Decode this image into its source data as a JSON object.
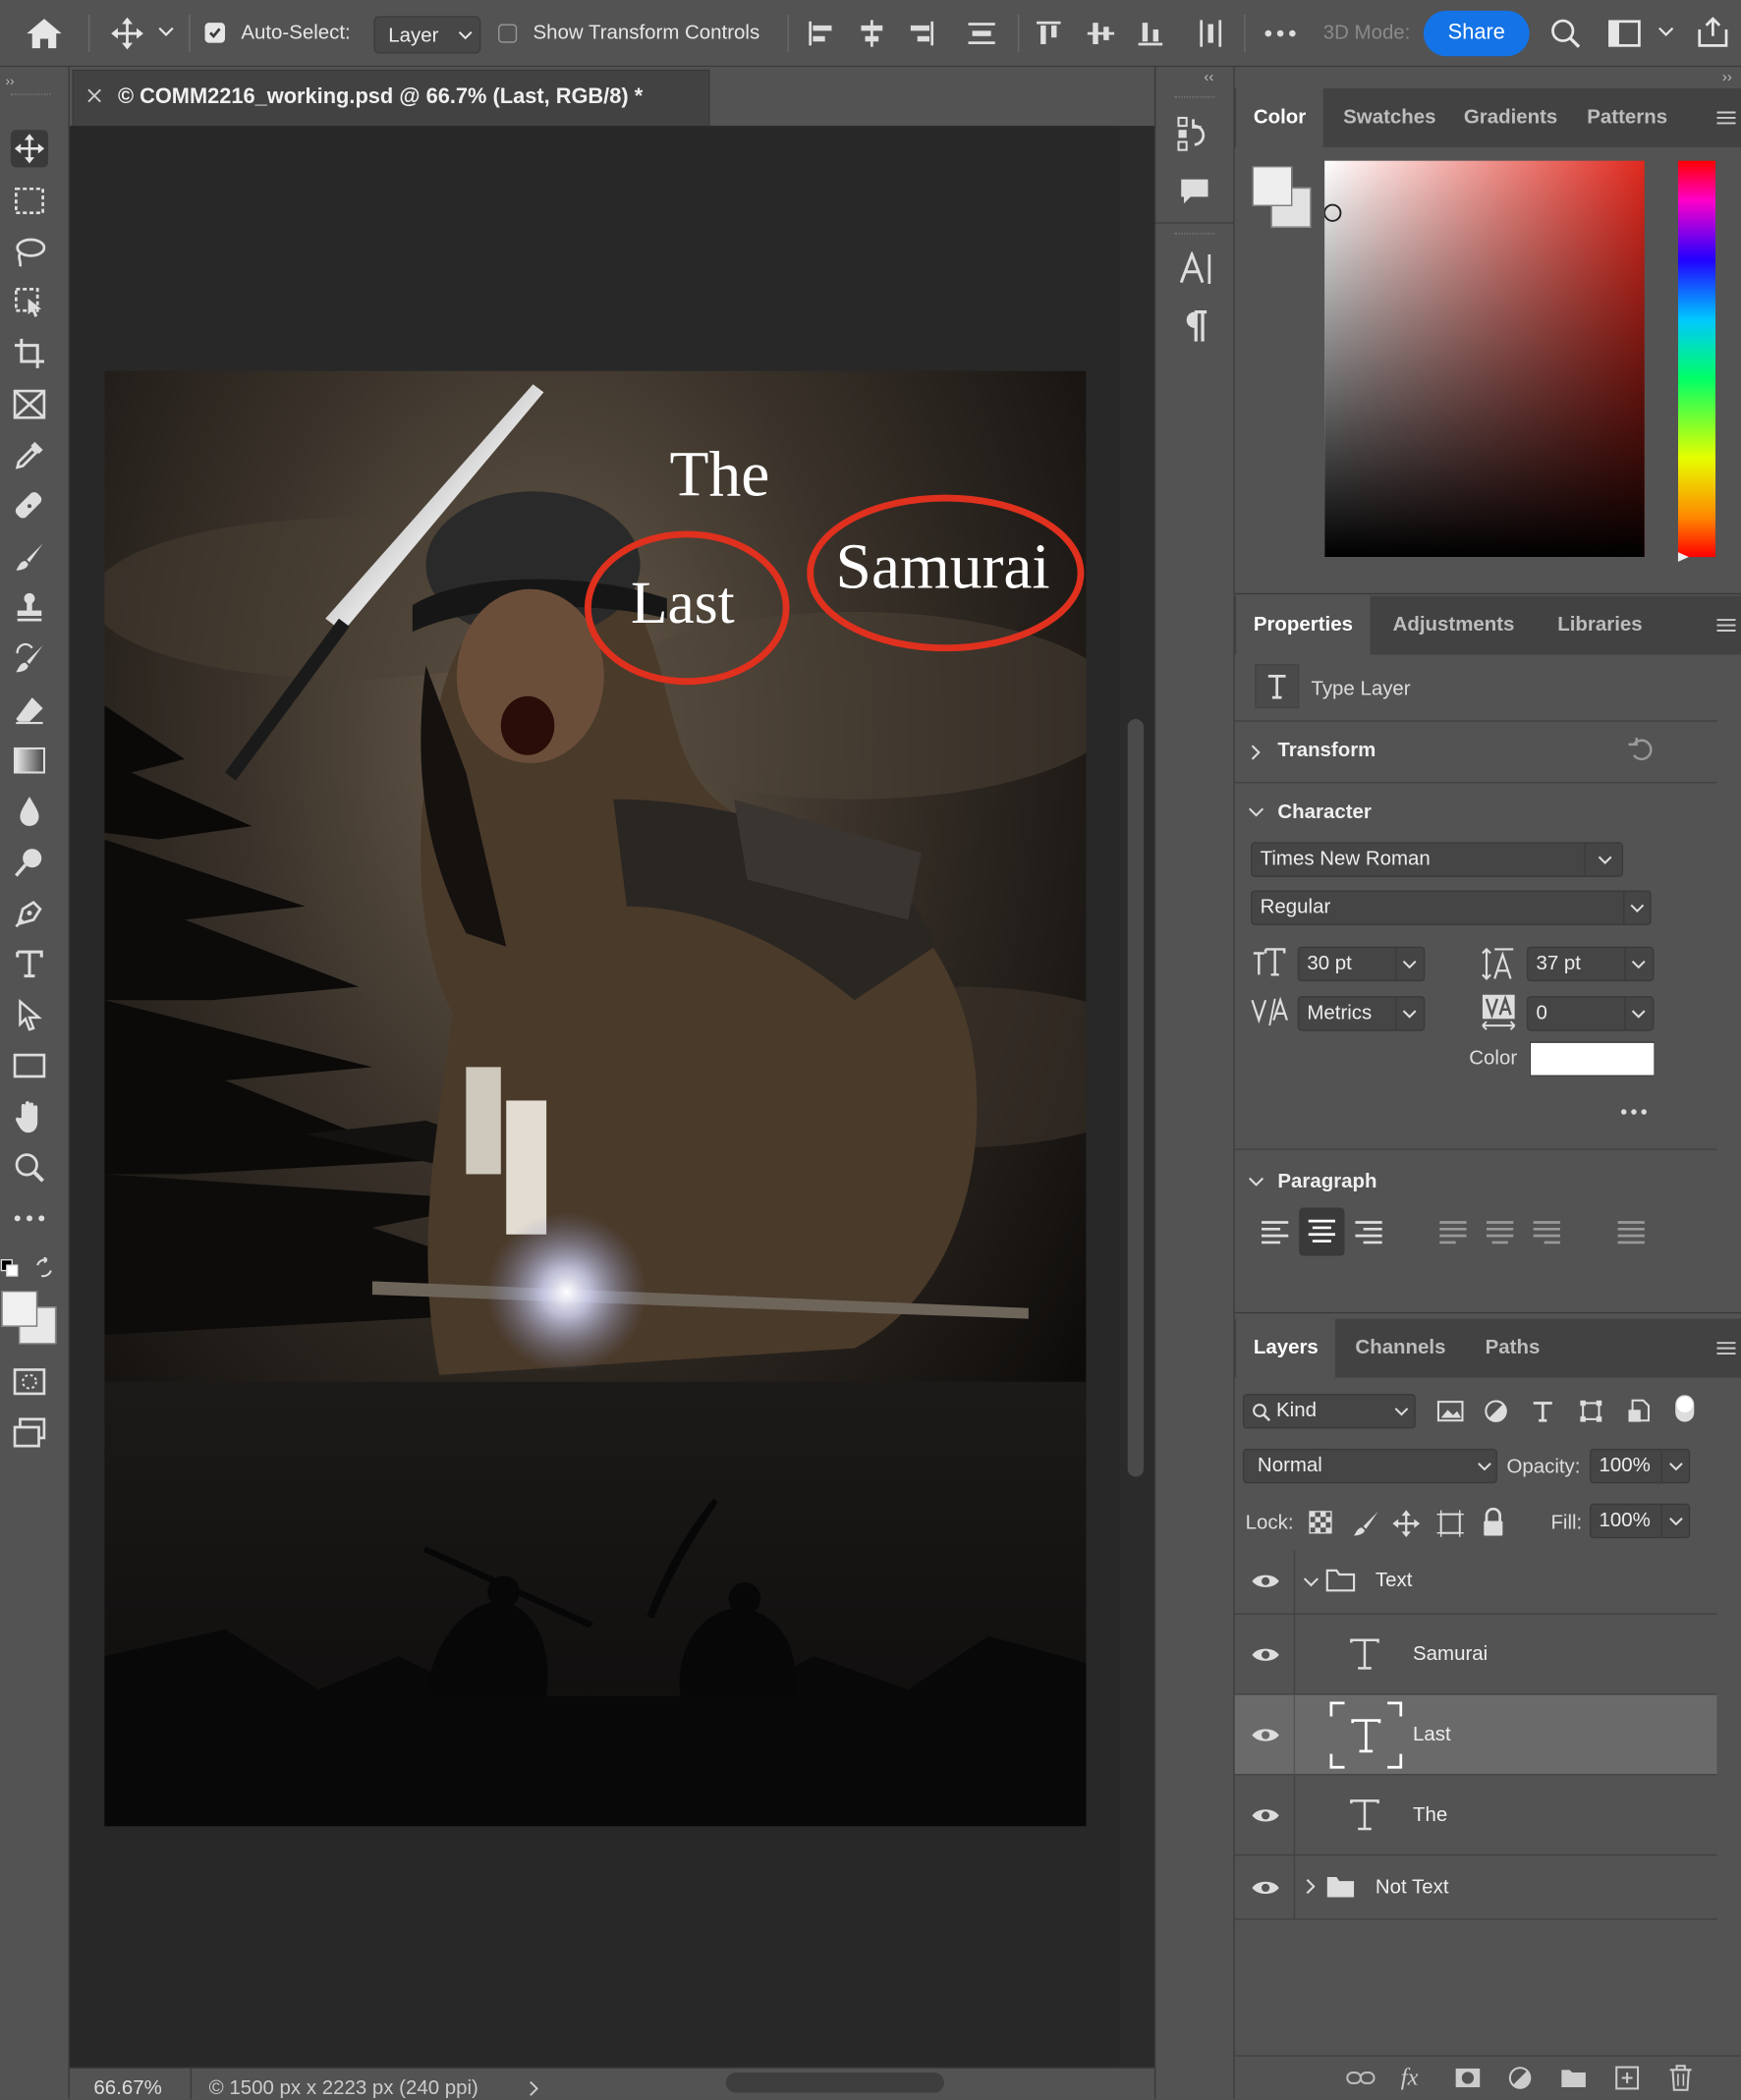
{
  "options_bar": {
    "auto_select_label": "Auto-Select:",
    "auto_select_value": "Layer",
    "show_transform_label": "Show Transform Controls",
    "mode_3d_label": "3D Mode:",
    "share_label": "Share",
    "colors": {
      "share_bg": "#1473e6"
    }
  },
  "document": {
    "tab_title": "© COMM2216_working.psd @ 66.7% (Last, RGB/8) *",
    "canvas_text": {
      "the": "The",
      "last": "Last",
      "samurai": "Samurai"
    },
    "annotation_color": "#e0301e"
  },
  "status": {
    "zoom": "66.67%",
    "doc_info": "© 1500 px x 2223 px (240 ppi)"
  },
  "color_panel": {
    "tabs": [
      "Color",
      "Swatches",
      "Gradients",
      "Patterns"
    ],
    "hue_color": "#e0291e"
  },
  "properties_panel": {
    "tabs": [
      "Properties",
      "Adjustments",
      "Libraries"
    ],
    "layer_kind": "Type Layer",
    "transform_label": "Transform",
    "character_label": "Character",
    "font_family": "Times New Roman",
    "font_style": "Regular",
    "font_size": "30 pt",
    "leading": "37 pt",
    "kerning": "Metrics",
    "tracking": "0",
    "color_label": "Color",
    "paragraph_label": "Paragraph"
  },
  "layers_panel": {
    "tabs": [
      "Layers",
      "Channels",
      "Paths"
    ],
    "filter_kind": "Kind",
    "blend_mode": "Normal",
    "opacity_label": "Opacity:",
    "opacity_value": "100%",
    "lock_label": "Lock:",
    "fill_label": "Fill:",
    "fill_value": "100%",
    "layers": [
      {
        "name": "Text",
        "type": "group"
      },
      {
        "name": "Samurai",
        "type": "text"
      },
      {
        "name": "Last",
        "type": "text",
        "selected": true
      },
      {
        "name": "The",
        "type": "text"
      },
      {
        "name": "Not Text",
        "type": "group"
      }
    ]
  }
}
